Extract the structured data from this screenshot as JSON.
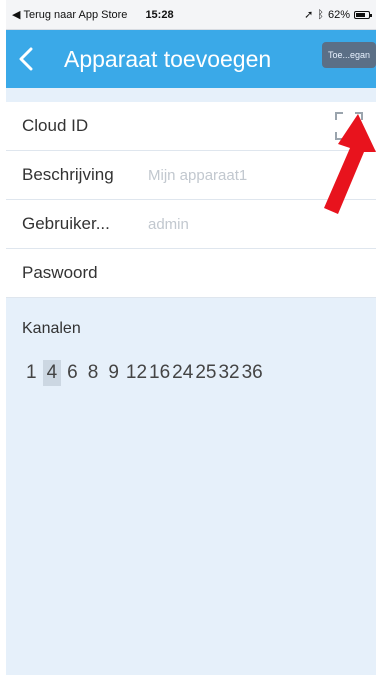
{
  "statusbar": {
    "back_to": "Terug naar App Store",
    "time": "15:28",
    "battery": "62%"
  },
  "navbar": {
    "title": "Apparaat toevoegen",
    "add_label": "Toe...egan"
  },
  "form": {
    "cloud_id": {
      "label": "Cloud ID",
      "value": ""
    },
    "description": {
      "label": "Beschrijving",
      "placeholder": "Mijn apparaat1"
    },
    "username": {
      "label": "Gebruiker...",
      "placeholder": "admin"
    },
    "password": {
      "label": "Paswoord",
      "placeholder": ""
    }
  },
  "channels": {
    "label": "Kanalen",
    "options": [
      "1",
      "4",
      "6",
      "8",
      "9",
      "12",
      "16",
      "24",
      "25",
      "32",
      "36"
    ],
    "selected": "4"
  },
  "colors": {
    "navbar": "#3aa9e8",
    "background": "#e6f0fa",
    "arrow": "#e8131d"
  },
  "icons": [
    "back-chevron-icon",
    "location-icon",
    "bluetooth-icon",
    "battery-icon",
    "qr-scan-icon",
    "annotation-arrow"
  ]
}
